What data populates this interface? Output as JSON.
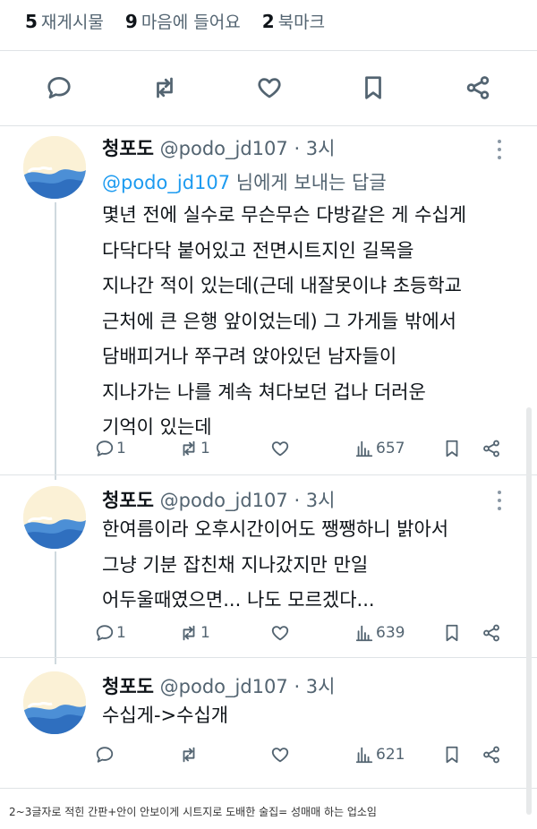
{
  "stats": {
    "reposts_count": "5",
    "reposts_label": "재게시물",
    "likes_count": "9",
    "likes_label": "마음에 들어요",
    "bookmarks_count": "2",
    "bookmarks_label": "북마크"
  },
  "main_actions": [
    "reply-icon",
    "repost-icon",
    "like-icon",
    "bookmark-icon",
    "share-icon"
  ],
  "colors": {
    "link": "#1d9bf0",
    "muted": "#536471",
    "text": "#0f1419",
    "divider": "#dfe3e6"
  },
  "replies": [
    {
      "name": "청포도",
      "handle": "@podo_jd107",
      "time": "· 3시",
      "replying_to_handle": "@podo_jd107",
      "replying_to_suffix": " 님에게 보내는 답글",
      "lines": [
        "몇년 전에 실수로 무슨무슨 다방같은 게 수십게",
        "다닥다닥 붙어있고 전면시트지인 길목을",
        "지나간 적이 있는데(근데 내잘못이냐 초등학교",
        "근처에 큰 은행 앞이었는데) 그 가게들 밖에서",
        "담배피거나 쭈구려 앉아있던 남자들이",
        "지나가는 나를 계속 쳐다보던 겁나 더러운",
        "기억이 있는데"
      ],
      "reply_count": "1",
      "repost_count": "1",
      "views": "657"
    },
    {
      "name": "청포도",
      "handle": "@podo_jd107",
      "time": "· 3시",
      "lines": [
        "한여름이라 오후시간이어도 쨍쨍하니 밝아서",
        "그냥 기분 잡친채 지나갔지만 만일",
        "어두울때였으면... 나도 모르겠다..."
      ],
      "reply_count": "1",
      "repost_count": "1",
      "views": "639"
    },
    {
      "name": "청포도",
      "handle": "@podo_jd107",
      "time": "· 3시",
      "lines": [
        "수십게->수십개"
      ],
      "views": "621"
    }
  ],
  "caption": "2~3글자로 적힌 간판+안이 안보이게 시트지로 도배한 술집= 성매매 하는 업소임"
}
